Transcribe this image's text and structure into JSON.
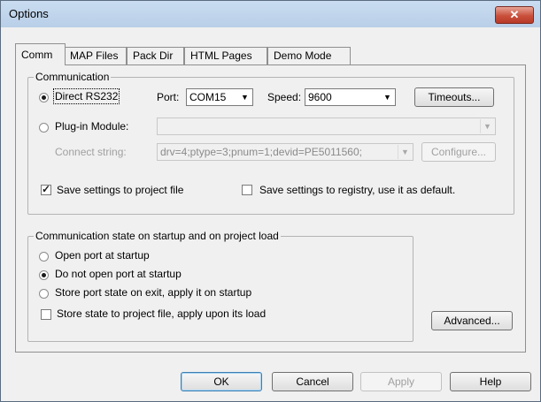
{
  "window": {
    "title": "Options",
    "close_glyph": "✕"
  },
  "tabs": [
    {
      "label": "Comm",
      "active": true
    },
    {
      "label": "MAP Files"
    },
    {
      "label": "Pack Dir"
    },
    {
      "label": "HTML Pages"
    },
    {
      "label": "Demo Mode"
    }
  ],
  "communication": {
    "legend": "Communication",
    "direct_rs232": {
      "label": "Direct RS232",
      "selected": true
    },
    "port_label": "Port:",
    "port_value": "COM15",
    "speed_label": "Speed:",
    "speed_value": "9600",
    "timeouts_button": "Timeouts...",
    "plugin_module": {
      "label": "Plug-in Module:",
      "selected": false,
      "value": ""
    },
    "connect_string_label": "Connect string:",
    "connect_string_value": "drv=4;ptype=3;pnum=1;devid=PE5011560;",
    "configure_button": "Configure...",
    "save_project": {
      "label": "Save settings to project file",
      "checked": true
    },
    "save_registry": {
      "label": "Save settings to registry, use it as default.",
      "checked": false
    }
  },
  "startup": {
    "legend": "Communication state on startup and on project load",
    "options": [
      {
        "label": "Open port at startup",
        "selected": false
      },
      {
        "label": "Do not open port at startup",
        "selected": true
      },
      {
        "label": "Store port state on exit, apply it on startup",
        "selected": false
      }
    ],
    "store_state": {
      "label": "Store state to project file, apply upon its load",
      "checked": false
    }
  },
  "advanced_button": "Advanced...",
  "footer": {
    "ok": "OK",
    "cancel": "Cancel",
    "apply": "Apply",
    "help": "Help"
  }
}
